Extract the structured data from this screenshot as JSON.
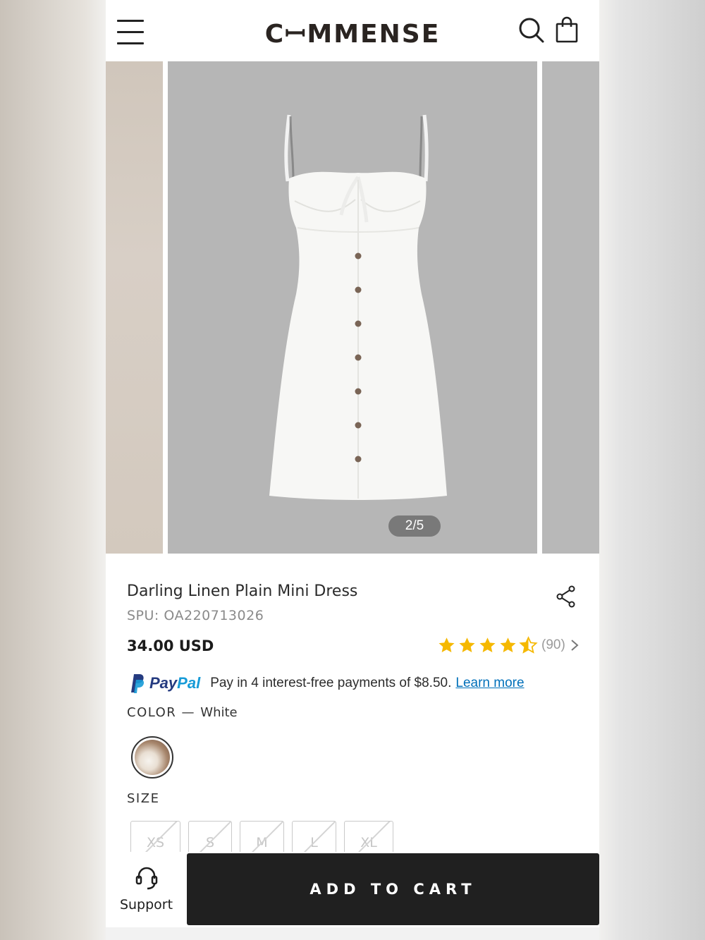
{
  "header": {
    "brand": "CꟷMMENSE",
    "icons": [
      "menu-icon",
      "search-icon",
      "shopping-bag-icon"
    ]
  },
  "gallery": {
    "counter": "2/5",
    "background_color": "#b6b6b6"
  },
  "product": {
    "title": "Darling Linen Plain Mini Dress",
    "spu": "SPU: OA220713026",
    "price": "34.00 USD",
    "rating_value": 4.5,
    "rating_count": "(90)"
  },
  "paypal": {
    "word_pay": "Pay",
    "word_pal": "Pal",
    "text": "Pay in 4 interest-free payments of $8.50.",
    "link": "Learn more"
  },
  "color": {
    "label": "COLOR",
    "separator": "—",
    "value": "White"
  },
  "size": {
    "label": "SIZE",
    "options": [
      "XS",
      "S",
      "M",
      "L",
      "XL"
    ]
  },
  "bottom_bar": {
    "support_label": "Support",
    "add_to_cart": "ADD TO CART"
  },
  "colors": {
    "star": "#f5b800",
    "paypal_dark": "#253b80",
    "paypal_light": "#179bd7",
    "link": "#0070ba",
    "button": "#202020"
  }
}
